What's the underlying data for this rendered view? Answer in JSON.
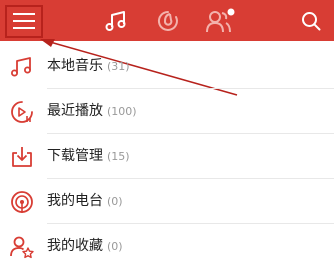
{
  "topbar": {
    "bg_color": "#d83d34",
    "menu_icon": "hamburger-menu-icon",
    "tabs": [
      {
        "icon": "music-note-icon",
        "active": true
      },
      {
        "icon": "netease-radio-icon",
        "active": false
      },
      {
        "icon": "friends-icon",
        "active": false,
        "has_dot": true
      }
    ],
    "search_icon": "search-icon"
  },
  "list": [
    {
      "label": "本地音乐",
      "count": "(31)",
      "icon": "music-note-icon"
    },
    {
      "label": "最近播放",
      "count": "(100)",
      "icon": "recent-play-icon"
    },
    {
      "label": "下载管理",
      "count": "(15)",
      "icon": "download-icon"
    },
    {
      "label": "我的电台",
      "count": "(0)",
      "icon": "my-radio-icon"
    },
    {
      "label": "我的收藏",
      "count": "(0)",
      "icon": "favorites-icon"
    }
  ],
  "colors": {
    "accent": "#d83d34",
    "annotation": "#b7221c",
    "count_text": "#999999"
  }
}
